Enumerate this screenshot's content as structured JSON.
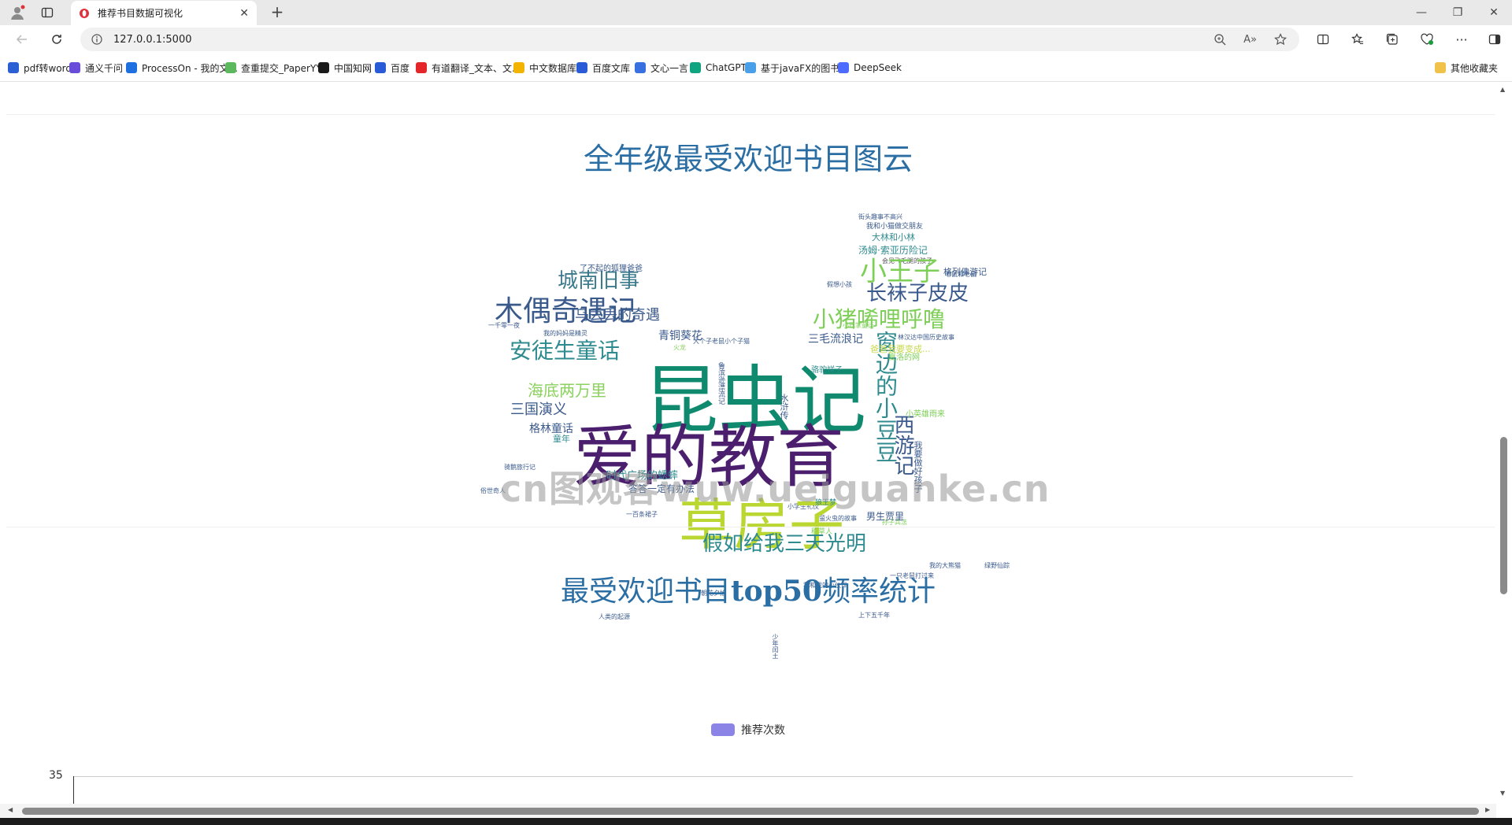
{
  "browser": {
    "tab_title": "推荐书目数据可视化",
    "address": "127.0.0.1:5000",
    "bookmarks": [
      {
        "label": "pdf转word",
        "color": "#2c5fd4"
      },
      {
        "label": "通义千问",
        "color": "#6a4cdb"
      },
      {
        "label": "ProcessOn - 我的文...",
        "color": "#1e6fe0"
      },
      {
        "label": "查重提交_PaperYY...",
        "color": "#5cb85c"
      },
      {
        "label": "中国知网",
        "color": "#1a1a1a"
      },
      {
        "label": "百度",
        "color": "#2a5bd7"
      },
      {
        "label": "有道翻译_文本、文...",
        "color": "#e4262b"
      },
      {
        "label": "中文数据库",
        "color": "#f2b400"
      },
      {
        "label": "百度文库",
        "color": "#2a5bd7"
      },
      {
        "label": "文心一言",
        "color": "#3870e0"
      },
      {
        "label": "ChatGPT",
        "color": "#10a37f"
      },
      {
        "label": "基于javaFX的图书...",
        "color": "#4aa0e8"
      },
      {
        "label": "DeepSeek",
        "color": "#4d6bfe"
      }
    ],
    "other_bookmarks": "其他收藏夹"
  },
  "page": {
    "cloud_title": "全年级最受欢迎书目图云",
    "chart_title_prefix": "最受欢迎书目",
    "chart_title_bold": "top50",
    "chart_title_suffix": "频率统计",
    "legend_label": "推荐次数",
    "y_tick": "35",
    "watermark": "cn图观客wuw.ueiguanke.cn"
  },
  "wordcloud": {
    "words": [
      {
        "text": "昆虫记",
        "color": "#0f8a6e"
      },
      {
        "text": "爱的教育",
        "color": "#4b1f6e"
      },
      {
        "text": "草房子",
        "color": "#b9d631"
      },
      {
        "text": "木偶奇遇记",
        "color": "#3b5a8c"
      },
      {
        "text": "小王子",
        "color": "#7ecf57"
      },
      {
        "text": "长袜子皮皮",
        "color": "#3b5a8c"
      },
      {
        "text": "城南旧事",
        "color": "#3b7a8c"
      },
      {
        "text": "小猪唏哩呼噜",
        "color": "#7ecf57"
      },
      {
        "text": "安徒生童话",
        "color": "#2f8b8f"
      },
      {
        "text": "假如给我三天光明",
        "color": "#2f8b8f"
      },
      {
        "text": "窗边的小豆豆",
        "color": "#2f8b8f"
      },
      {
        "text": "西游记",
        "color": "#3b5a8c"
      },
      {
        "text": "三国演义",
        "color": "#3b5a8c"
      },
      {
        "text": "海底两万里",
        "color": "#8bd15e"
      },
      {
        "text": "乌丢丢的奇遇",
        "color": "#3b5a8c"
      },
      {
        "text": "格林童话",
        "color": "#3b5a8c"
      },
      {
        "text": "时代广场的蟋蟀",
        "color": "#2f8b8f"
      },
      {
        "text": "青铜葵花",
        "color": "#3b5a8c"
      },
      {
        "text": "三毛流浪记",
        "color": "#3b5a8c"
      },
      {
        "text": "男生贾里",
        "color": "#3b5a8c"
      },
      {
        "text": "了不起的狐狸爸爸",
        "color": "#3b5a8c"
      },
      {
        "text": "大林和小林",
        "color": "#2f8b8f"
      },
      {
        "text": "汤姆·索亚历险记",
        "color": "#2f8b8f"
      },
      {
        "text": "格列佛游记",
        "color": "#3b5a8c"
      },
      {
        "text": "爸爸我要变成...",
        "color": "#c7d84a"
      },
      {
        "text": "答答一定有办法",
        "color": "#3b5a8c"
      },
      {
        "text": "骆驼祥子",
        "color": "#2f8b8f"
      },
      {
        "text": "夏洛的网",
        "color": "#7ecf57"
      },
      {
        "text": "水浒传",
        "color": "#3b5a8c"
      },
      {
        "text": "我要做好孩子",
        "color": "#3b5a8c"
      },
      {
        "text": "狼王梦",
        "color": "#2f8b8f"
      },
      {
        "text": "稻草人",
        "color": "#7ecf57"
      },
      {
        "text": "鲁滨逊漂流记",
        "color": "#3b5a8c"
      },
      {
        "text": "童年",
        "color": "#2f8b8f"
      },
      {
        "text": "小英雄雨来",
        "color": "#7ecf57"
      }
    ]
  }
}
